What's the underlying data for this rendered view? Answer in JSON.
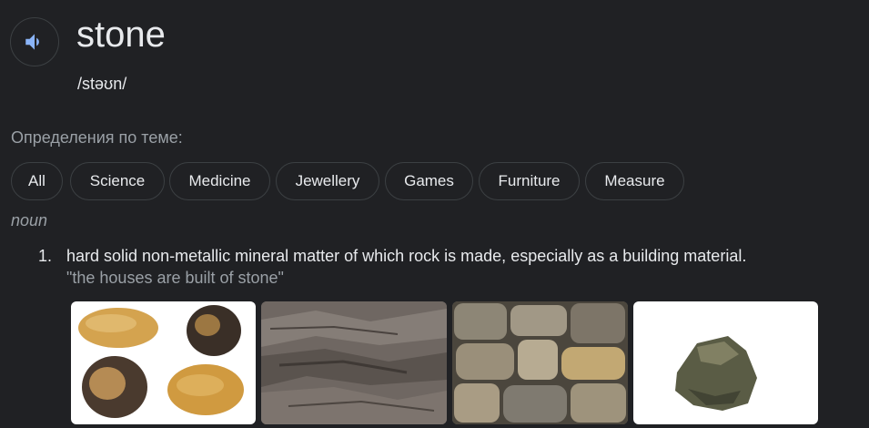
{
  "word": "stone",
  "phonetic": "/stəʊn/",
  "topics_label": "Определения по теме:",
  "topics": [
    "All",
    "Science",
    "Medicine",
    "Jewellery",
    "Games",
    "Furniture",
    "Measure"
  ],
  "part_of_speech": "noun",
  "definitions": [
    {
      "number": "1.",
      "text": "hard solid non-metallic mineral matter of which rock is made, especially as a building material.",
      "example": "\"the houses are built of stone\""
    }
  ],
  "images": [
    "assorted-stones-image",
    "rock-surface-image",
    "stone-wall-image",
    "single-stone-image"
  ],
  "icons": {
    "speaker": "speaker-icon"
  },
  "colors": {
    "background": "#202124",
    "text": "#e8eaed",
    "muted": "#9aa0a6",
    "border": "#3c4043",
    "accent": "#8ab4f8"
  }
}
